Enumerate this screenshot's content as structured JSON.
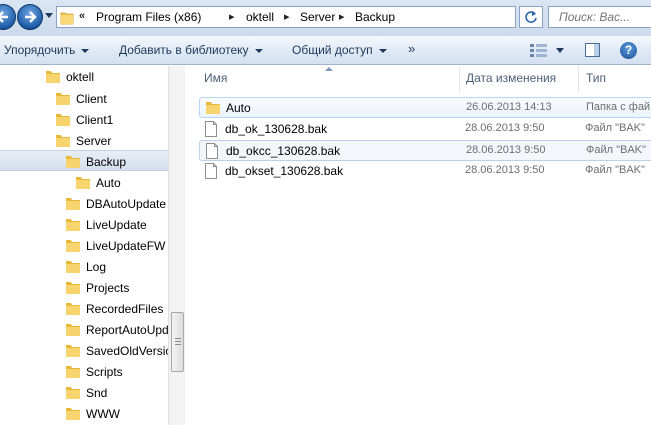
{
  "navigation": {
    "back_icon": "back-arrow-icon",
    "forward_icon": "forward-arrow-icon"
  },
  "address": {
    "overflow": "«",
    "crumbs": [
      "Program Files (x86)",
      "oktell",
      "Server",
      "Backup"
    ],
    "separator": "▸"
  },
  "search": {
    "placeholder": "Поиск: Вас..."
  },
  "toolbar": {
    "organize": "Упорядочить",
    "add_to_library": "Добавить в библиотеку",
    "share": "Общий доступ",
    "more": "»",
    "help": "?"
  },
  "tree": {
    "items": [
      {
        "label": "oktell"
      },
      {
        "label": "Client"
      },
      {
        "label": "Client1"
      },
      {
        "label": "Server"
      },
      {
        "label": "Backup",
        "selected": true
      },
      {
        "label": "Auto"
      },
      {
        "label": "DBAutoUpdate"
      },
      {
        "label": "LiveUpdate"
      },
      {
        "label": "LiveUpdateFW"
      },
      {
        "label": "Log"
      },
      {
        "label": "Projects"
      },
      {
        "label": "RecordedFiles"
      },
      {
        "label": "ReportAutoUpd"
      },
      {
        "label": "SavedOldVersio"
      },
      {
        "label": "Scripts"
      },
      {
        "label": "Snd"
      },
      {
        "label": "WWW"
      }
    ]
  },
  "columns": {
    "name": "Имя",
    "date": "Дата изменения",
    "type": "Тип"
  },
  "files": [
    {
      "name": "Auto",
      "date": "26.06.2013 14:13",
      "type": "Папка с фай",
      "icon": "folder-icon"
    },
    {
      "name": "db_ok_130628.bak",
      "date": "28.06.2013 9:50",
      "type": "Файл \"BAK\"",
      "icon": "file-icon"
    },
    {
      "name": "db_okcc_130628.bak",
      "date": "28.06.2013 9:50",
      "type": "Файл \"BAK\"",
      "icon": "file-icon"
    },
    {
      "name": "db_okset_130628.bak",
      "date": "28.06.2013 9:50",
      "type": "Файл \"BAK\"",
      "icon": "file-icon"
    }
  ],
  "colors": {
    "toolbar_text": "#1e395b",
    "selection": "#d5deea",
    "folder": "#f2c54b"
  }
}
